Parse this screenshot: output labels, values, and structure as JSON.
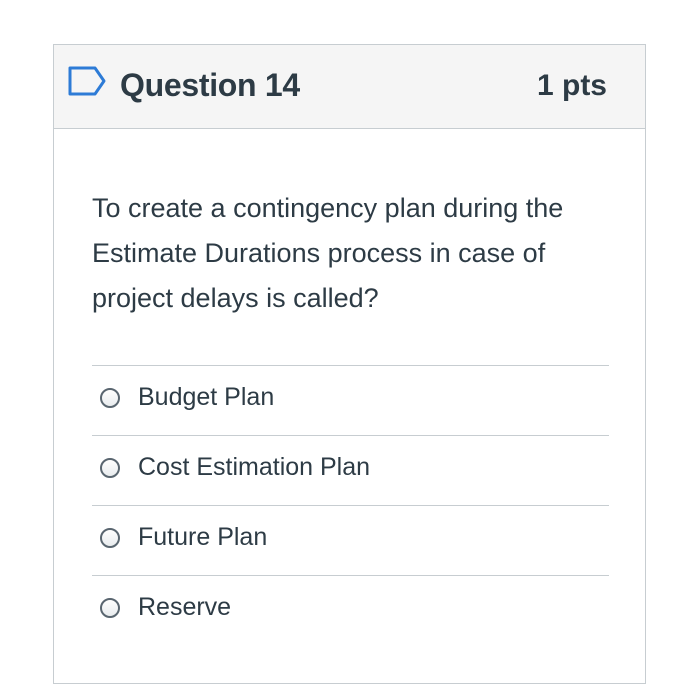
{
  "question": {
    "title": "Question 14",
    "points": "1 pts",
    "flag_icon": "bookmark-flag-icon",
    "prompt": "To create a contingency plan during the Estimate Durations process in case of project delays is called?",
    "answers": [
      {
        "label": "Budget Plan",
        "selected": false
      },
      {
        "label": "Cost Estimation Plan",
        "selected": false
      },
      {
        "label": "Future Plan",
        "selected": false
      },
      {
        "label": "Reserve",
        "selected": false
      }
    ]
  },
  "colors": {
    "text": "#2d3b45",
    "border": "#c7cdd1",
    "header_bg": "#f5f5f5",
    "flag": "#2d7bd6"
  }
}
